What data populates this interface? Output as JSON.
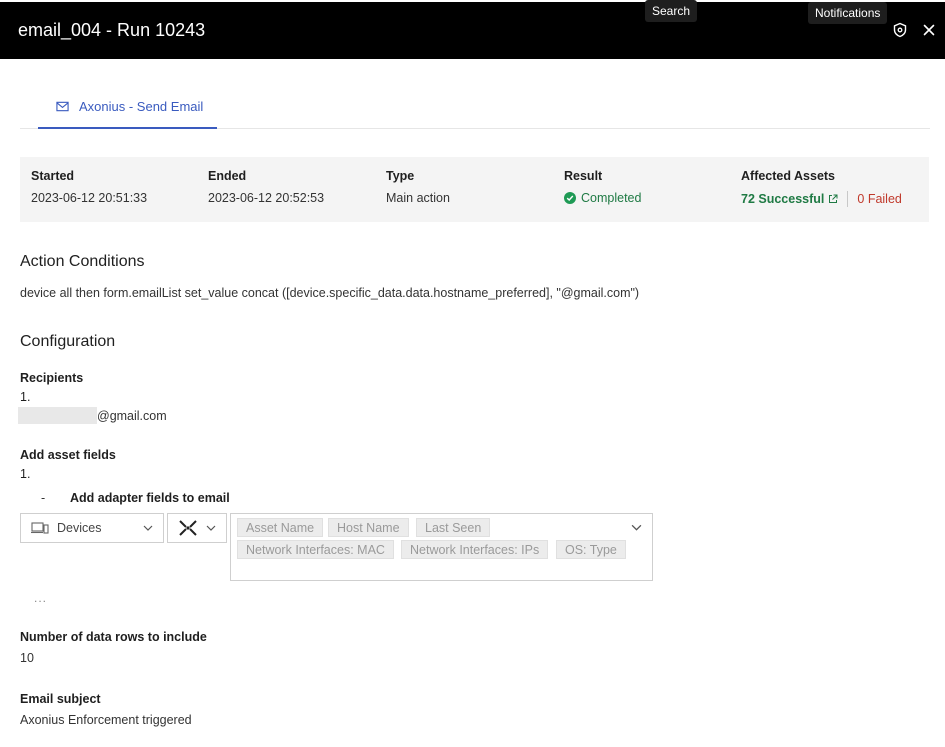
{
  "header": {
    "title": "email_004 - Run 10243",
    "tooltip_search": "Search",
    "tooltip_notifications": "Notifications"
  },
  "tabs": [
    {
      "label": "Axonius - Send Email"
    }
  ],
  "summary": {
    "started_label": "Started",
    "started_value": "2023-06-12 20:51:33",
    "ended_label": "Ended",
    "ended_value": "2023-06-12 20:52:53",
    "type_label": "Type",
    "type_value": "Main action",
    "result_label": "Result",
    "result_value": "Completed",
    "assets_label": "Affected Assets",
    "assets_successful": "72 Successful",
    "assets_failed": "0 Failed"
  },
  "action_conditions": {
    "title": "Action Conditions",
    "text": "device all then form.emailList set_value concat ([device.specific_data.data.hostname_preferred], \"@gmail.com\")"
  },
  "configuration": {
    "title": "Configuration",
    "recipients_label": "Recipients",
    "recipients_index": "1.",
    "recipient_suffix": "@gmail.com",
    "asset_fields_label": "Add asset fields",
    "asset_fields_index": "1.",
    "adapter_fields_bullet": "-",
    "adapter_fields_label": "Add adapter fields to email",
    "entity_dropdown_value": "Devices",
    "fields": [
      "Asset Name",
      "Host Name",
      "Last Seen",
      "Network Interfaces: MAC",
      "Network Interfaces: IPs",
      "OS: Type"
    ],
    "more": "...",
    "rows_label": "Number of data rows to include",
    "rows_value": "10",
    "subject_label": "Email subject",
    "subject_value": "Axonius Enforcement triggered"
  },
  "colors": {
    "accent": "#3a5bbf",
    "success": "#1f7a44",
    "danger": "#c0392b"
  }
}
